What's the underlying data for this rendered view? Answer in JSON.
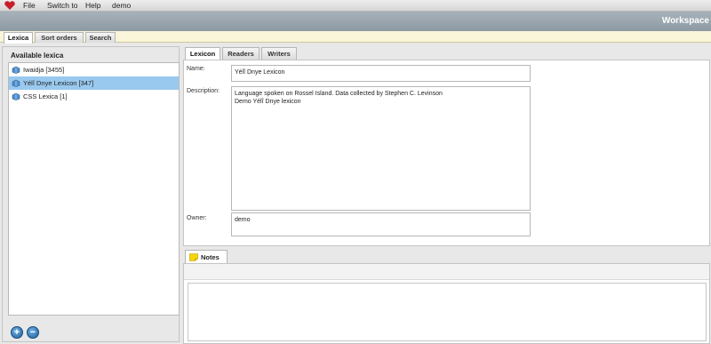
{
  "menubar": {
    "items": [
      "File",
      "Switch to",
      "Help",
      "demo"
    ]
  },
  "workspace": {
    "title": "Workspace"
  },
  "top_tabs": [
    "Lexica",
    "Sort orders",
    "Search"
  ],
  "left_panel": {
    "title": "Available lexica",
    "lexica": [
      {
        "label": "Iwaidja [3455]",
        "selected": false
      },
      {
        "label": "Yélî Dnye Lexicon [347]",
        "selected": true
      },
      {
        "label": "CSS Lexica [1]",
        "selected": false
      }
    ],
    "add_label": "+",
    "remove_label": "−"
  },
  "right_panel": {
    "tabs": [
      "Lexicon",
      "Readers",
      "Writers"
    ],
    "form": {
      "name_label": "Name:",
      "name_value": "Yélî Dnye Lexicon",
      "description_label": "Description:",
      "description_line1": "Language spoken on Rossel Island. Data collected by Stephen C. Levinson",
      "description_line2": "Demo Yélî Dnye lexicon",
      "owner_label": "Owner:",
      "owner_value": "demo"
    },
    "notes_tab": "Notes"
  },
  "colors": {
    "selected_row": "#99c9ef",
    "workspace_bar": "#96a2ab",
    "tab_strip": "#f8f5d8",
    "logo": "#c8202b"
  }
}
